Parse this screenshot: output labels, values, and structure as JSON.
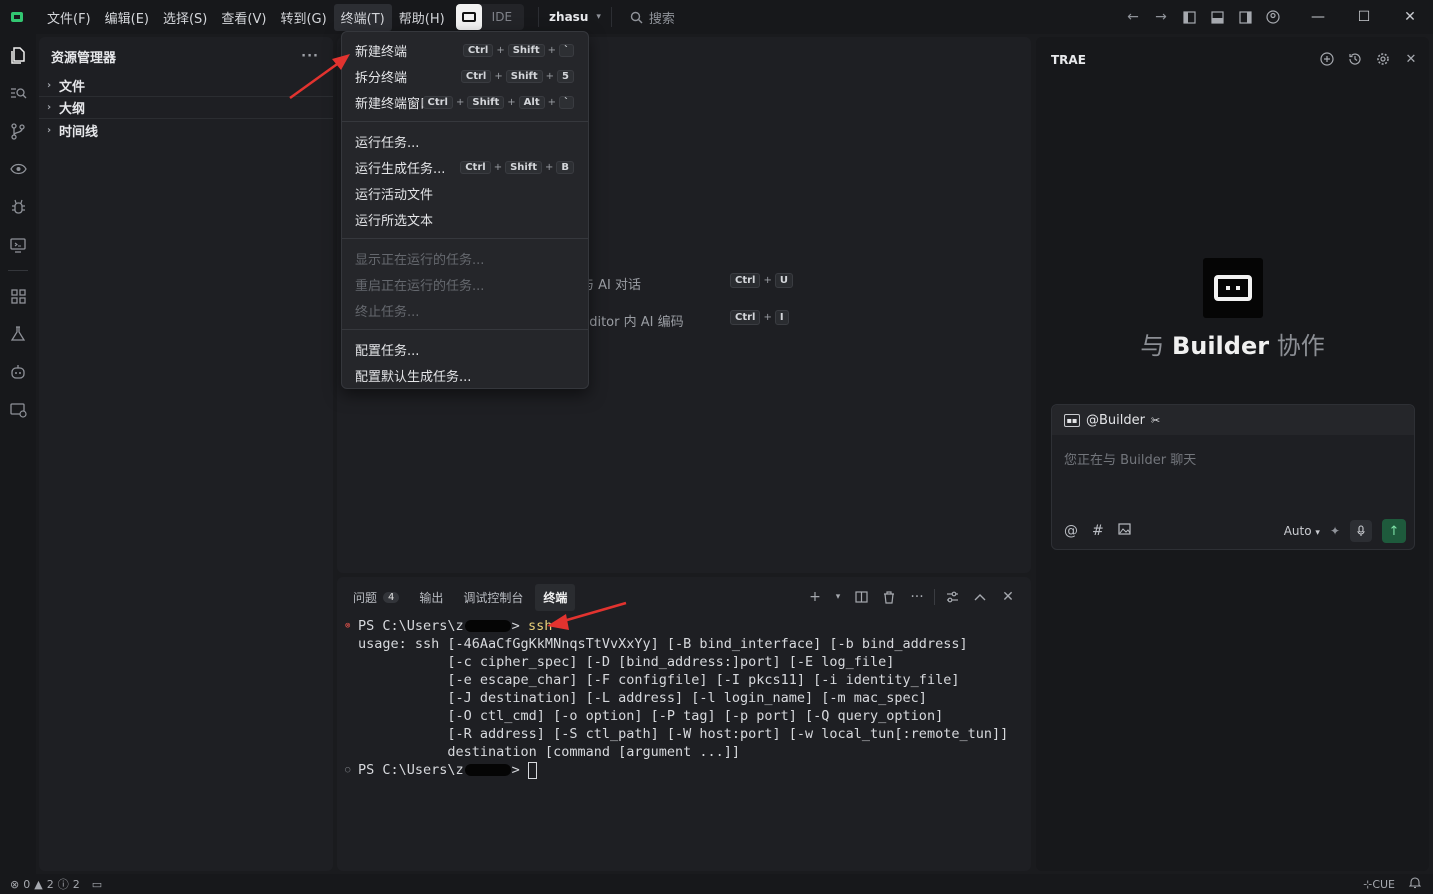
{
  "menubar": {
    "items": [
      "文件(F)",
      "编辑(E)",
      "选择(S)",
      "查看(V)",
      "转到(G)",
      "终端(T)",
      "帮助(H)"
    ],
    "active_index": 5,
    "ide_label": "IDE",
    "user": "zhasu",
    "search_placeholder": "搜索"
  },
  "sidebar": {
    "title": "资源管理器",
    "more": "···",
    "sections": [
      "文件",
      "大纲",
      "时间线"
    ]
  },
  "terminal_menu": {
    "items": [
      {
        "label": "新建终端",
        "shortcut": [
          "Ctrl",
          "+",
          "Shift",
          "+",
          "`"
        ],
        "disabled": false
      },
      {
        "label": "拆分终端",
        "shortcut": [
          "Ctrl",
          "+",
          "Shift",
          "+",
          "5"
        ],
        "disabled": false
      },
      {
        "label": "新建终端窗口",
        "shortcut": [
          "Ctrl",
          "+",
          "Shift",
          "+",
          "Alt",
          "+",
          "`"
        ],
        "disabled": false
      },
      {
        "label": "运行任务...",
        "shortcut": [],
        "disabled": false
      },
      {
        "label": "运行生成任务...",
        "shortcut": [
          "Ctrl",
          "+",
          "Shift",
          "+",
          "B"
        ],
        "disabled": false
      },
      {
        "label": "运行活动文件",
        "shortcut": [],
        "disabled": false
      },
      {
        "label": "运行所选文本",
        "shortcut": [],
        "disabled": false
      },
      {
        "label": "显示正在运行的任务...",
        "shortcut": [],
        "disabled": true
      },
      {
        "label": "重启正在运行的任务...",
        "shortcut": [],
        "disabled": true
      },
      {
        "label": "终止任务...",
        "shortcut": [],
        "disabled": true
      },
      {
        "label": "配置任务...",
        "shortcut": [],
        "disabled": false
      },
      {
        "label": "配置默认生成任务...",
        "shortcut": [],
        "disabled": false
      }
    ]
  },
  "editor": {
    "hints": [
      {
        "text": "与 AI 对话",
        "keys": [
          "Ctrl",
          "+",
          "U"
        ]
      },
      {
        "text": "Editor 内 AI 编码",
        "keys": [
          "Ctrl",
          "+",
          "I"
        ]
      }
    ]
  },
  "panel": {
    "tabs": [
      {
        "label": "问题",
        "count": "4"
      },
      {
        "label": "输出",
        "count": ""
      },
      {
        "label": "调试控制台",
        "count": ""
      },
      {
        "label": "终端",
        "count": ""
      }
    ],
    "active_tab": 3,
    "terminal": {
      "prompt1_prefix": "PS C:\\Users\\z",
      "prompt1_suffix": "> ",
      "command": "ssh",
      "usage_lines": [
        "usage: ssh [-46AaCfGgKkMNnqsTtVvXxYy] [-B bind_interface] [-b bind_address]",
        "           [-c cipher_spec] [-D [bind_address:]port] [-E log_file]",
        "           [-e escape_char] [-F configfile] [-I pkcs11] [-i identity_file]",
        "           [-J destination] [-L address] [-l login_name] [-m mac_spec]",
        "           [-O ctl_cmd] [-o option] [-P tag] [-p port] [-Q query_option]",
        "           [-R address] [-S ctl_path] [-W host:port] [-w local_tun[:remote_tun]]",
        "           destination [command [argument ...]]"
      ],
      "prompt2_prefix": "PS C:\\Users\\z",
      "prompt2_suffix": "> "
    }
  },
  "right_panel": {
    "title": "TRAE",
    "hero_prefix": "与 ",
    "hero_bold": "Builder",
    "hero_suffix": " 协作",
    "chat_agent": "@Builder",
    "chat_placeholder": "您正在与 Builder 聊天",
    "model": "Auto"
  },
  "statusbar": {
    "errors": "0",
    "warnings": "2",
    "infos": "2",
    "cue": "CUE"
  },
  "colors": {
    "accent_green": "#32c671",
    "error_red": "#e0524b",
    "command_yellow": "#e9d07a",
    "arrow_red": "#e2332f"
  }
}
